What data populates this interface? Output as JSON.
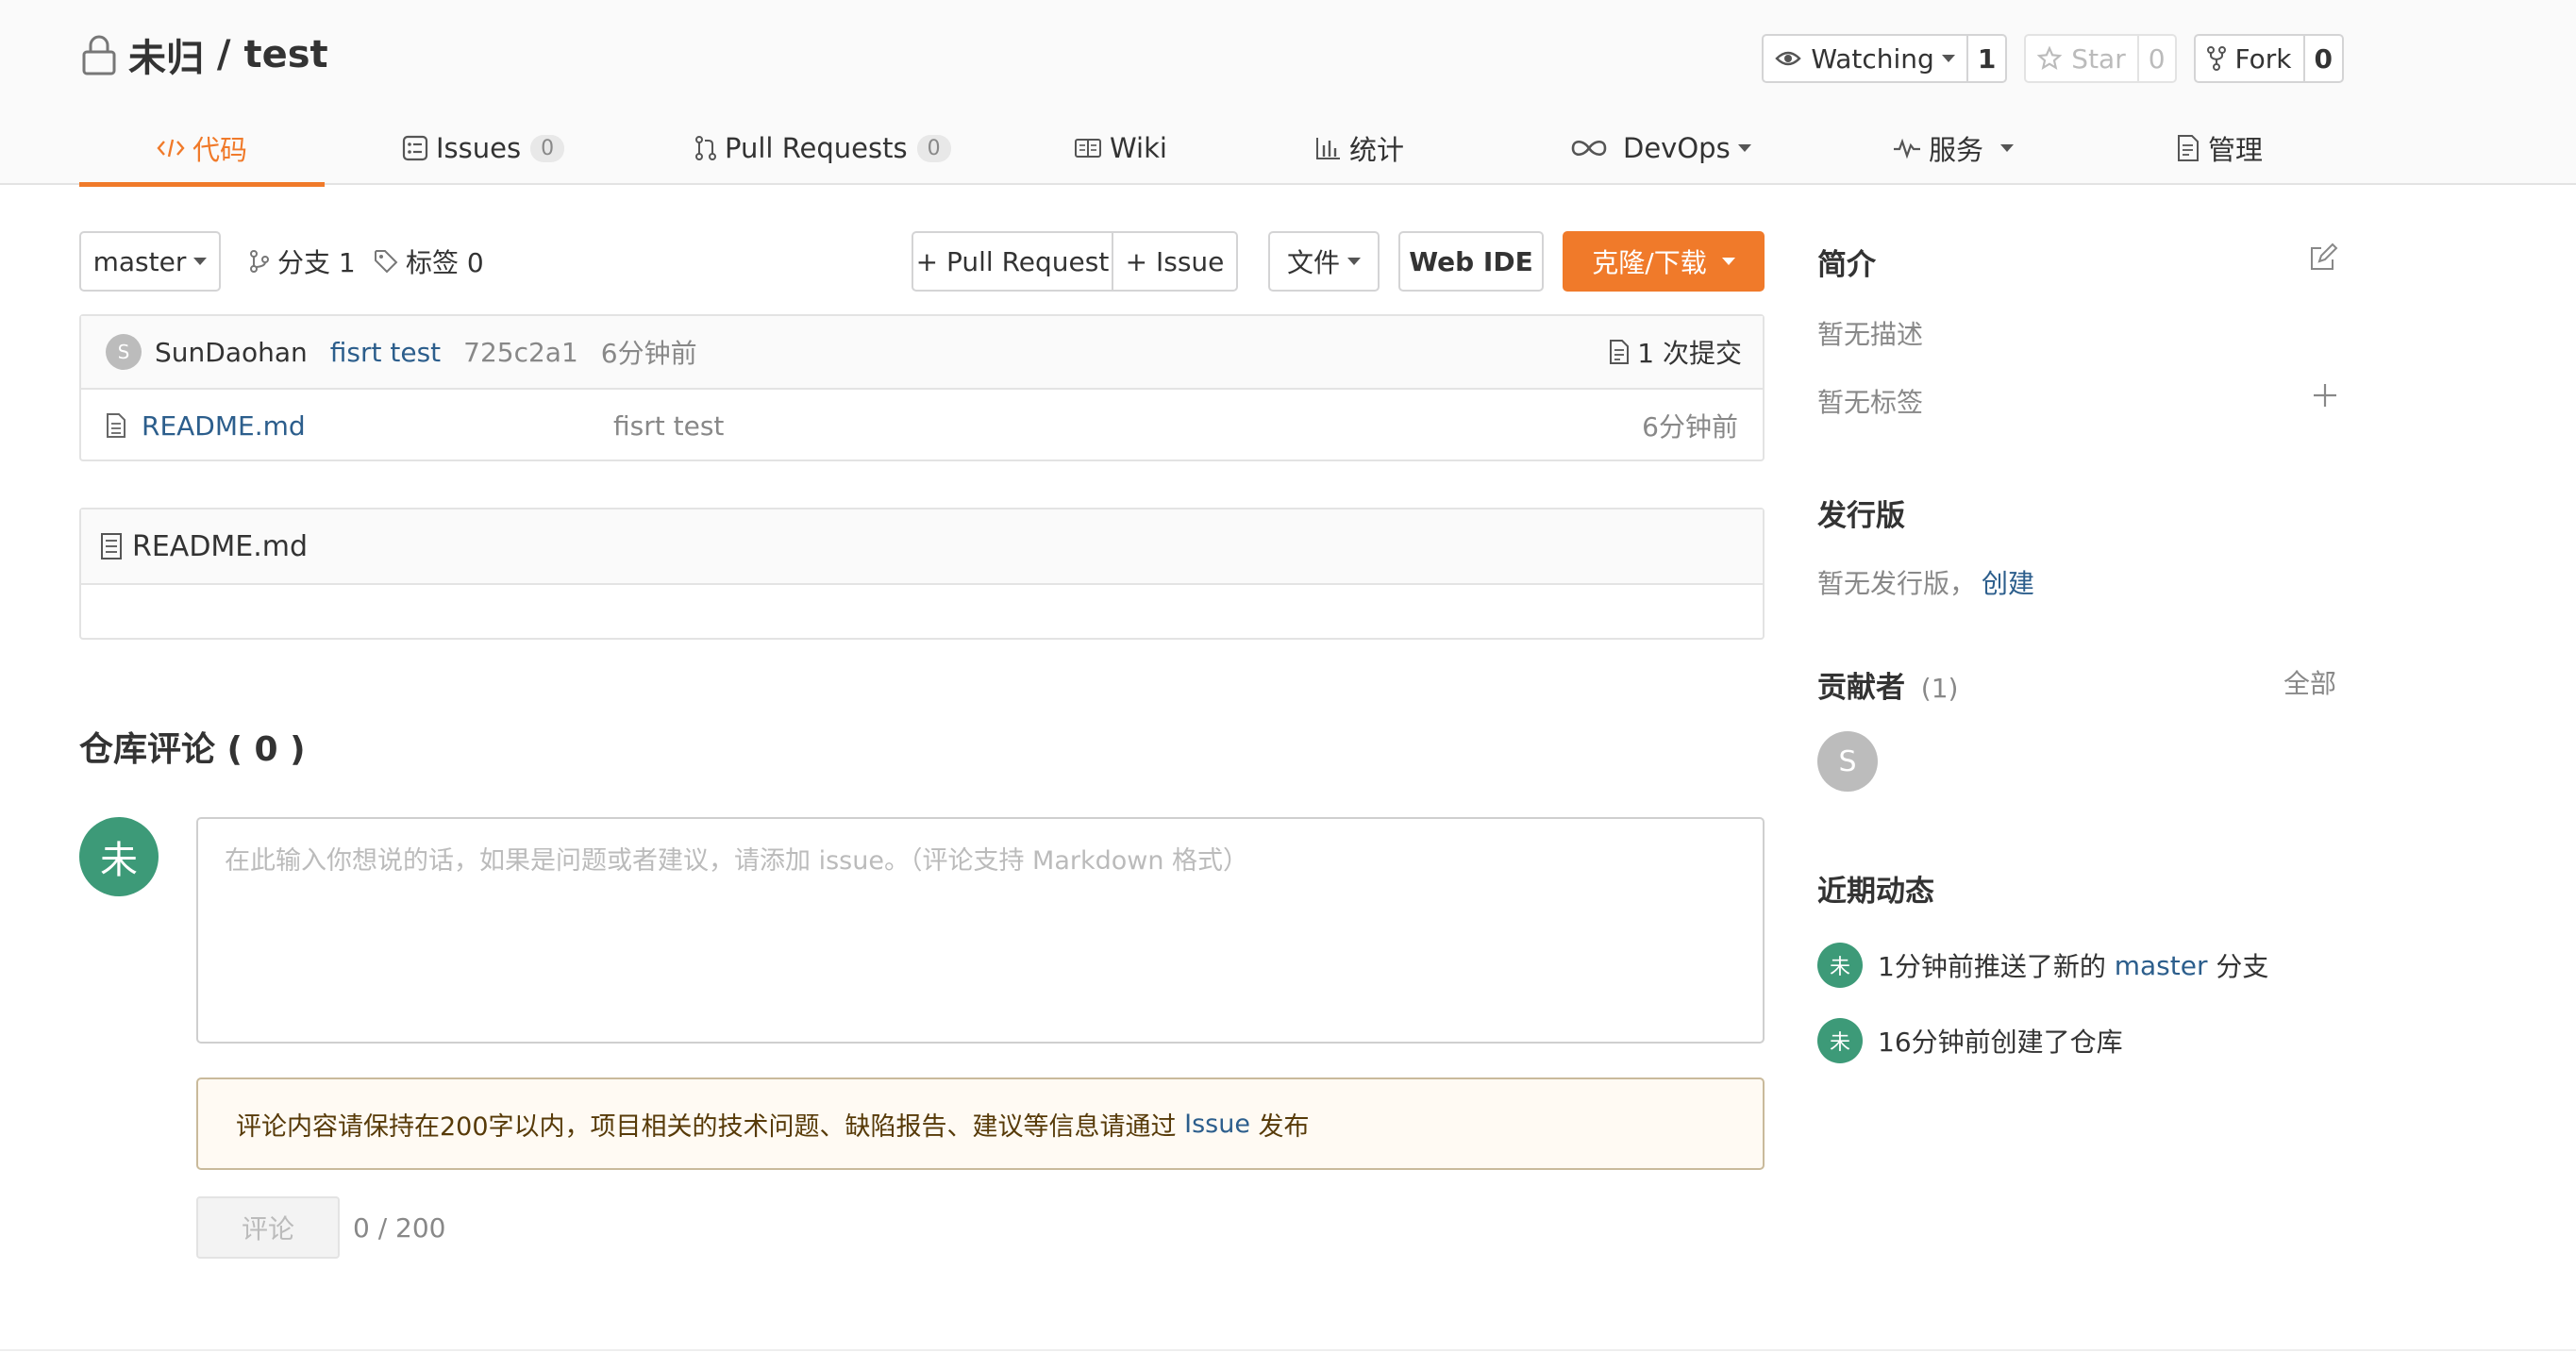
{
  "repo": {
    "owner": "未归",
    "separator": " / ",
    "name": "test"
  },
  "actions": {
    "watch": {
      "label": "Watching",
      "count": "1"
    },
    "star": {
      "label": "Star",
      "count": "0"
    },
    "fork": {
      "label": "Fork",
      "count": "0"
    }
  },
  "tabs": [
    {
      "label": "代码"
    },
    {
      "label": "Issues",
      "badge": "0"
    },
    {
      "label": "Pull Requests",
      "badge": "0"
    },
    {
      "label": "Wiki"
    },
    {
      "label": "统计"
    },
    {
      "label": "DevOps"
    },
    {
      "label": "服务"
    },
    {
      "label": "管理"
    }
  ],
  "toolbar": {
    "branch": "master",
    "branches_label": "分支 1",
    "tags_label": "标签 0",
    "pull_request": "+ Pull Request",
    "issue": "+ Issue",
    "file": "文件",
    "web_ide": "Web IDE",
    "clone": "克隆/下载"
  },
  "commit": {
    "avatar": "S",
    "author": "SunDaohan",
    "message": "fisrt test",
    "hash": "725c2a1",
    "time": "6分钟前",
    "count_label": "1 次提交"
  },
  "files": [
    {
      "name": "README.md",
      "message": "fisrt test",
      "time": "6分钟前"
    }
  ],
  "readme": {
    "title": "README.md"
  },
  "comments": {
    "title": "仓库评论 ( 0 )",
    "avatar": "未",
    "placeholder": "在此输入你想说的话，如果是问题或者建议，请添加 issue。（评论支持 Markdown 格式）",
    "notice_prefix": "评论内容请保持在200字以内，项目相关的技术问题、缺陷报告、建议等信息请通过 ",
    "notice_link": "Issue",
    "notice_suffix": " 发布",
    "submit": "评论",
    "counter": "0 / 200"
  },
  "sidebar": {
    "intro_title": "简介",
    "no_description": "暂无描述",
    "no_tags": "暂无标签",
    "releases_title": "发行版",
    "no_releases": "暂无发行版，",
    "create_link": "创建",
    "contributors_title": "贡献者",
    "contributors_count": "(1)",
    "all_link": "全部",
    "contributor_avatar": "S",
    "activity_title": "近期动态",
    "activity": [
      {
        "avatar": "未",
        "prefix": "1分钟前推送了新的 ",
        "link": "master",
        "suffix": " 分支"
      },
      {
        "avatar": "未",
        "prefix": "16分钟前创建了仓库",
        "link": "",
        "suffix": ""
      }
    ]
  },
  "colors": {
    "accent": "#f07a2a",
    "link": "#2c5e8c",
    "avatar_green": "#3d9a78"
  }
}
